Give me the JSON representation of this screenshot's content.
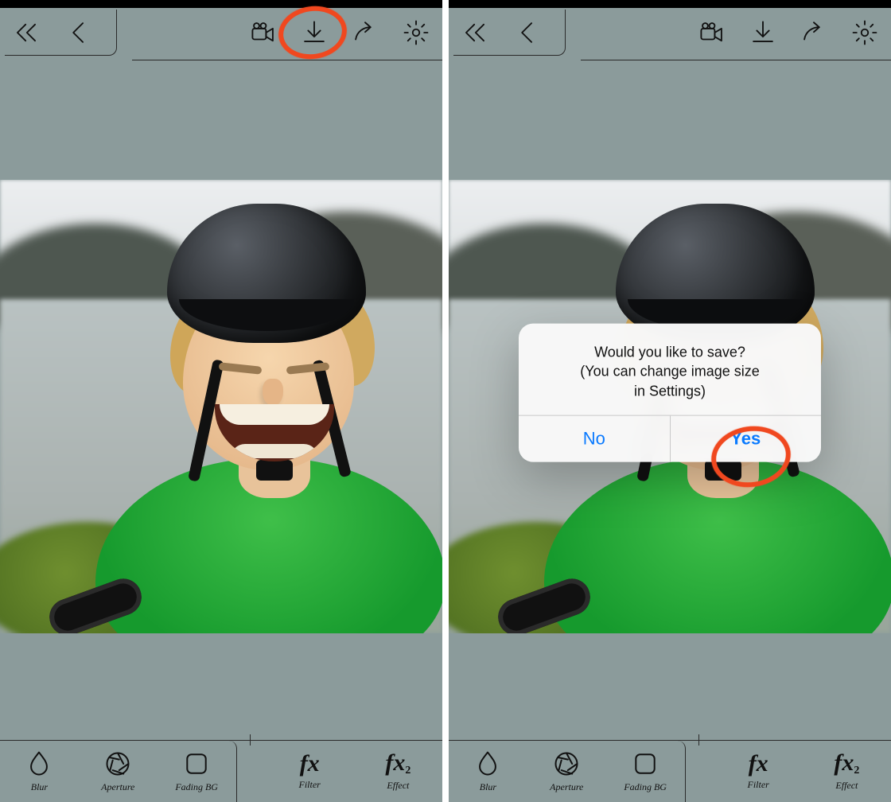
{
  "toolbar": {
    "back_all_icon": "chevrons-left-icon",
    "back_icon": "chevron-left-icon",
    "camera_icon": "video-camera-icon",
    "download_icon": "download-icon",
    "share_icon": "share-arrow-icon",
    "settings_icon": "gear-icon"
  },
  "tools": [
    {
      "id": "blur",
      "label": "Blur",
      "icon": "droplet-icon"
    },
    {
      "id": "aperture",
      "label": "Aperture",
      "icon": "aperture-icon"
    },
    {
      "id": "fading-bg",
      "label": "Fading BG",
      "icon": "rounded-square-icon"
    },
    {
      "id": "filter",
      "label": "Filter",
      "icon": "fx-icon"
    },
    {
      "id": "effect",
      "label": "Effect",
      "icon": "fx2-icon"
    }
  ],
  "dialog": {
    "line1": "Would you like to save?",
    "line2": "(You can change image size",
    "line3": "in Settings)",
    "no_label": "No",
    "yes_label": "Yes"
  },
  "annotations": {
    "left_target": "download-icon",
    "right_target": "dialog-yes-button"
  }
}
